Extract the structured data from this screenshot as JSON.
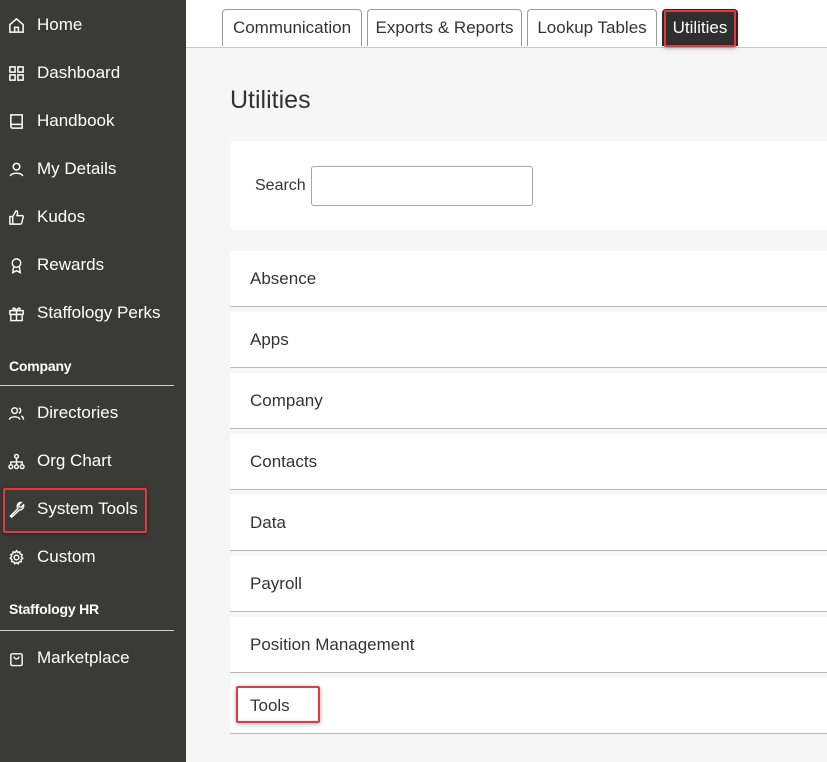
{
  "sidebar": {
    "items": [
      {
        "label": "Home",
        "icon": "home-icon"
      },
      {
        "label": "Dashboard",
        "icon": "grid-icon"
      },
      {
        "label": "Handbook",
        "icon": "book-icon"
      },
      {
        "label": "My Details",
        "icon": "user-icon"
      },
      {
        "label": "Kudos",
        "icon": "thumbs-up-icon"
      },
      {
        "label": "Rewards",
        "icon": "award-icon"
      },
      {
        "label": "Staffology Perks",
        "icon": "gift-icon"
      }
    ],
    "company_heading": "Company",
    "company_items": [
      {
        "label": "Directories",
        "icon": "users-icon"
      },
      {
        "label": "Org Chart",
        "icon": "org-chart-icon"
      },
      {
        "label": "System Tools",
        "icon": "wrench-icon"
      },
      {
        "label": "Custom",
        "icon": "gear-icon"
      }
    ],
    "hr_heading": "Staffology HR",
    "hr_items": [
      {
        "label": "Marketplace",
        "icon": "shopping-bag-icon"
      }
    ]
  },
  "tabs": [
    {
      "label": "Communication"
    },
    {
      "label": "Exports & Reports"
    },
    {
      "label": "Lookup Tables"
    },
    {
      "label": "Utilities",
      "active": true
    }
  ],
  "page_title": "Utilities",
  "search": {
    "label": "Search",
    "value": ""
  },
  "utilities": [
    {
      "label": "Absence"
    },
    {
      "label": "Apps"
    },
    {
      "label": "Company"
    },
    {
      "label": "Contacts"
    },
    {
      "label": "Data"
    },
    {
      "label": "Payroll"
    },
    {
      "label": "Position Management"
    },
    {
      "label": "Tools"
    }
  ],
  "colors": {
    "sidebar_bg": "#3a3a37",
    "active_tab_bg": "#2f2f2f",
    "highlight": "#e0393e",
    "page_bg": "#f6f6f7"
  }
}
